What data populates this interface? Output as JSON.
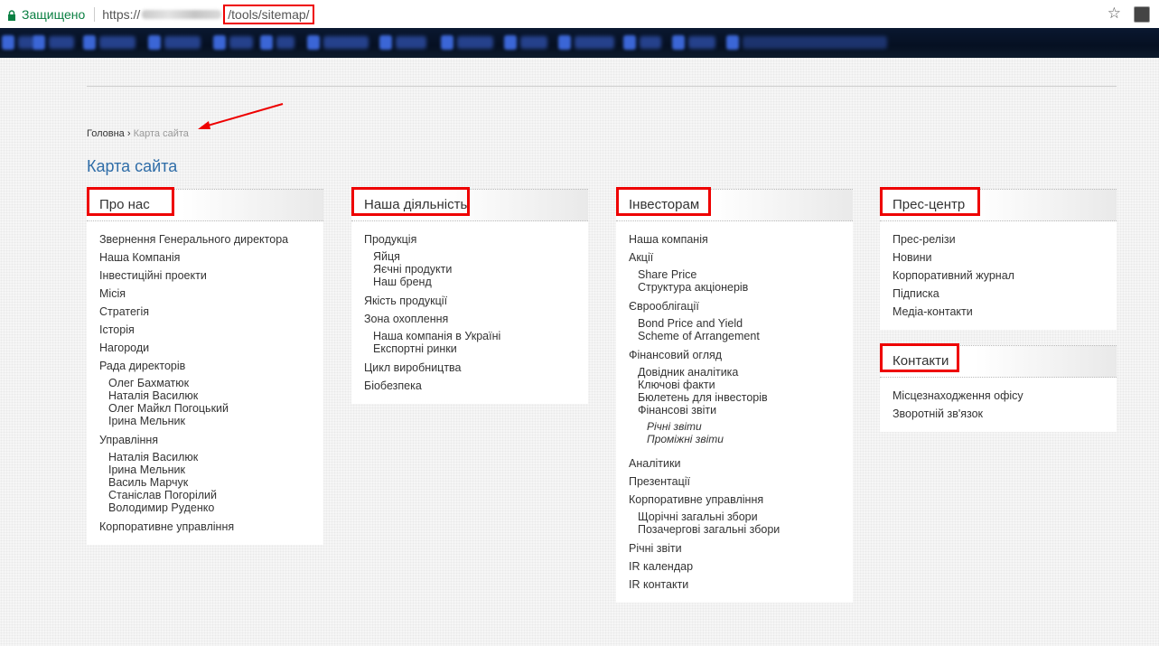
{
  "browser": {
    "secure_label": "Защищено",
    "url_scheme": "https://",
    "url_path": "/tools/sitemap/"
  },
  "breadcrumb": {
    "home": "Головна",
    "separator": "›",
    "current": "Карта сайта"
  },
  "page_title": "Карта сайта",
  "columns": [
    {
      "title": "Про нас",
      "items": [
        {
          "label": "Звернення Генерального директора"
        },
        {
          "label": "Наша Компанія"
        },
        {
          "label": "Інвестиційні проекти"
        },
        {
          "label": "Місія"
        },
        {
          "label": "Стратегія"
        },
        {
          "label": "Історія"
        },
        {
          "label": "Нагороди"
        },
        {
          "label": "Рада директорів",
          "children": [
            {
              "label": "Олег Бахматюк"
            },
            {
              "label": "Наталія Василюк"
            },
            {
              "label": "Олег Майкл Погоцький"
            },
            {
              "label": "Ірина Мельник"
            }
          ]
        },
        {
          "label": "Управління",
          "children": [
            {
              "label": "Наталія Василюк"
            },
            {
              "label": "Ірина Мельник"
            },
            {
              "label": "Василь Марчук"
            },
            {
              "label": "Станіслав Погорілий"
            },
            {
              "label": "Володимир Руденко"
            }
          ]
        },
        {
          "label": "Корпоративне управління"
        }
      ]
    },
    {
      "title": "Наша діяльність",
      "items": [
        {
          "label": "Продукція",
          "children": [
            {
              "label": "Яйця"
            },
            {
              "label": "Яєчні продукти"
            },
            {
              "label": "Наш бренд"
            }
          ]
        },
        {
          "label": "Якість продукції"
        },
        {
          "label": "Зона охоплення",
          "children": [
            {
              "label": "Наша компанія в Україні"
            },
            {
              "label": "Експортні ринки"
            }
          ]
        },
        {
          "label": "Цикл виробництва"
        },
        {
          "label": "Біобезпека"
        }
      ]
    },
    {
      "title": "Інвесторам",
      "items": [
        {
          "label": "Наша компанія"
        },
        {
          "label": "Акції",
          "children": [
            {
              "label": "Share Price"
            },
            {
              "label": "Структура акціонерів"
            }
          ]
        },
        {
          "label": "Єврооблігації",
          "children": [
            {
              "label": "Bond Price and Yield"
            },
            {
              "label": "Scheme of Arrangement"
            }
          ]
        },
        {
          "label": "Фінансовий огляд",
          "children": [
            {
              "label": "Довідник аналітика"
            },
            {
              "label": "Ключові факти"
            },
            {
              "label": "Бюлетень для інвесторів"
            },
            {
              "label": "Фінансові звіти",
              "children": [
                {
                  "label": "Річні звіти"
                },
                {
                  "label": "Проміжні звіти"
                }
              ]
            }
          ]
        },
        {
          "label": "Аналітики"
        },
        {
          "label": "Презентації"
        },
        {
          "label": "Корпоративне управління",
          "children": [
            {
              "label": "Щорічні загальні збори"
            },
            {
              "label": "Позачергові загальні збори"
            }
          ]
        },
        {
          "label": "Річні звіти"
        },
        {
          "label": "IR календар"
        },
        {
          "label": "IR контакти"
        }
      ]
    },
    {
      "title": "Прес-центр",
      "items": [
        {
          "label": "Прес-релізи"
        },
        {
          "label": "Новини"
        },
        {
          "label": "Корпоративний журнал"
        },
        {
          "label": "Підписка"
        },
        {
          "label": "Медіа-контакти"
        }
      ]
    },
    {
      "title": "Контакти",
      "items": [
        {
          "label": "Місцезнаходження офісу"
        },
        {
          "label": "Зворотній зв'язок"
        }
      ]
    }
  ],
  "colors": {
    "highlight": "#e00000",
    "title": "#2f6da8",
    "secure": "#0b8043"
  }
}
